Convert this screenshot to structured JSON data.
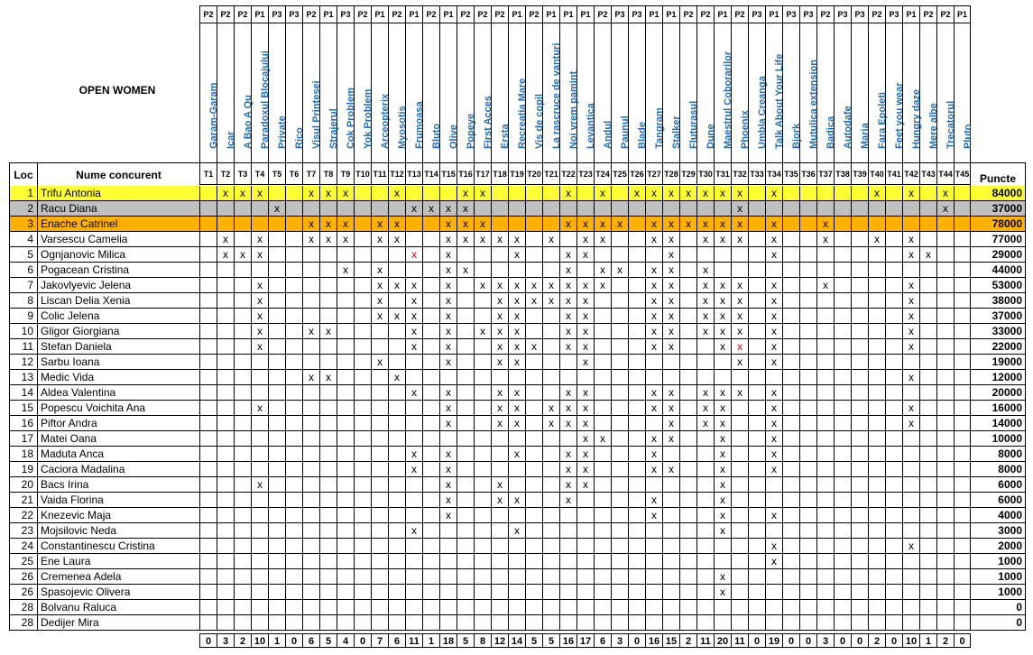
{
  "title": "OPEN WOMEN",
  "headers": {
    "loc": "Loc",
    "name": "Nume concurent",
    "points": "Puncte"
  },
  "routes": [
    {
      "code": "T1",
      "level": "P2",
      "name": "Garam-Garam"
    },
    {
      "code": "T2",
      "level": "P2",
      "name": "Icar"
    },
    {
      "code": "T3",
      "level": "P2",
      "name": "A Bao A Qu"
    },
    {
      "code": "T4",
      "level": "P1",
      "name": "Paradoxul Blocajului"
    },
    {
      "code": "T5",
      "level": "P3",
      "name": "Private"
    },
    {
      "code": "T6",
      "level": "P3",
      "name": "Rico"
    },
    {
      "code": "T7",
      "level": "P2",
      "name": "Visul Printesei"
    },
    {
      "code": "T8",
      "level": "P1",
      "name": "Strajerul"
    },
    {
      "code": "T9",
      "level": "P3",
      "name": "Cok Problem"
    },
    {
      "code": "T10",
      "level": "P2",
      "name": "Yok Problem"
    },
    {
      "code": "T11",
      "level": "P1",
      "name": "Arceopterix"
    },
    {
      "code": "T12",
      "level": "P2",
      "name": "Myosotis"
    },
    {
      "code": "T13",
      "level": "P1",
      "name": "Frumoasa"
    },
    {
      "code": "T14",
      "level": "P2",
      "name": "Bluto"
    },
    {
      "code": "T15",
      "level": "P1",
      "name": "Olive"
    },
    {
      "code": "T16",
      "level": "P2",
      "name": "Popeye"
    },
    {
      "code": "T17",
      "level": "P2",
      "name": "First Acces"
    },
    {
      "code": "T18",
      "level": "P2",
      "name": "Ersta"
    },
    {
      "code": "T19",
      "level": "P1",
      "name": "Recreatia Mare"
    },
    {
      "code": "T20",
      "level": "P2",
      "name": "Vis de copil"
    },
    {
      "code": "T21",
      "level": "P1",
      "name": "La rascruce de vanturi"
    },
    {
      "code": "T22",
      "level": "P1",
      "name": "Noi vrem pamint"
    },
    {
      "code": "T23",
      "level": "P1",
      "name": "Levantica"
    },
    {
      "code": "T24",
      "level": "P2",
      "name": "Andul"
    },
    {
      "code": "T25",
      "level": "P3",
      "name": "Paunul"
    },
    {
      "code": "T26",
      "level": "P3",
      "name": "Blade"
    },
    {
      "code": "T27",
      "level": "P1",
      "name": "Tangram"
    },
    {
      "code": "T28",
      "level": "P1",
      "name": "Stalker"
    },
    {
      "code": "T29",
      "level": "P2",
      "name": "Fluturasul"
    },
    {
      "code": "T30",
      "level": "P2",
      "name": "Dune"
    },
    {
      "code": "T31",
      "level": "P1",
      "name": "Maestrul Coborarilor"
    },
    {
      "code": "T32",
      "level": "P2",
      "name": "Phoenix"
    },
    {
      "code": "T33",
      "level": "P3",
      "name": "Umbla Creanga"
    },
    {
      "code": "T34",
      "level": "P1",
      "name": "Talk About Your Life"
    },
    {
      "code": "T35",
      "level": "P3",
      "name": "Bjork"
    },
    {
      "code": "T36",
      "level": "P3",
      "name": "Mutulica extension"
    },
    {
      "code": "T37",
      "level": "P2",
      "name": "Badica"
    },
    {
      "code": "T38",
      "level": "P3",
      "name": "Autodafe"
    },
    {
      "code": "T39",
      "level": "P3",
      "name": "Maria"
    },
    {
      "code": "T40",
      "level": "P2",
      "name": "Fara Epoleti"
    },
    {
      "code": "T41",
      "level": "P3",
      "name": "Feet you wear"
    },
    {
      "code": "T42",
      "level": "P1",
      "name": "Hungry daze"
    },
    {
      "code": "T43",
      "level": "P2",
      "name": "Mere albe"
    },
    {
      "code": "T44",
      "level": "P2",
      "name": "Trecatorul"
    },
    {
      "code": "T45",
      "level": "P1",
      "name": "Pluto"
    }
  ],
  "rows": [
    {
      "rank": "1",
      "name": "Trifu Antonia",
      "hl": "yellow",
      "marks": [
        2,
        3,
        4,
        7,
        8,
        9,
        12,
        16,
        17,
        22,
        24,
        26,
        27,
        28,
        29,
        30,
        31,
        32,
        34,
        40,
        42,
        44
      ],
      "red": [],
      "points": "84000"
    },
    {
      "rank": "2",
      "name": "Racu Diana",
      "hl": "gray",
      "marks": [
        5,
        13,
        14,
        15,
        16,
        32,
        44
      ],
      "red": [],
      "points": "37000"
    },
    {
      "rank": "3",
      "name": "Enache Catrinel",
      "hl": "orange",
      "marks": [
        7,
        8,
        9,
        11,
        12,
        15,
        16,
        17,
        22,
        23,
        24,
        25,
        27,
        28,
        29,
        30,
        31,
        32,
        34,
        37
      ],
      "red": [],
      "points": "78000"
    },
    {
      "rank": "4",
      "name": "Varsescu Camelia",
      "hl": "",
      "marks": [
        2,
        4,
        7,
        8,
        9,
        11,
        12,
        15,
        16,
        17,
        18,
        19,
        21,
        23,
        24,
        27,
        28,
        30,
        31,
        32,
        34,
        37,
        40,
        42
      ],
      "red": [],
      "points": "77000"
    },
    {
      "rank": "5",
      "name": "Ognjanovic Milica",
      "hl": "",
      "marks": [
        2,
        3,
        4,
        13,
        15,
        19,
        22,
        23,
        28,
        34,
        42,
        43
      ],
      "red": [
        13
      ],
      "points": "29000"
    },
    {
      "rank": "6",
      "name": "Pogacean Cristina",
      "hl": "",
      "marks": [
        9,
        11,
        15,
        16,
        22,
        24,
        25,
        27,
        28,
        30
      ],
      "red": [],
      "points": "44000"
    },
    {
      "rank": "7",
      "name": "Jakovlyevic Jelena",
      "hl": "",
      "marks": [
        4,
        11,
        12,
        13,
        15,
        17,
        18,
        19,
        20,
        21,
        22,
        23,
        24,
        27,
        28,
        30,
        31,
        32,
        34,
        37,
        42
      ],
      "red": [],
      "points": "53000"
    },
    {
      "rank": "8",
      "name": "Liscan Delia Xenia",
      "hl": "",
      "marks": [
        4,
        11,
        13,
        15,
        18,
        19,
        20,
        21,
        22,
        23,
        27,
        28,
        30,
        31,
        32,
        34,
        42
      ],
      "red": [],
      "points": "38000"
    },
    {
      "rank": "9",
      "name": "Colic Jelena",
      "hl": "",
      "marks": [
        4,
        11,
        12,
        13,
        15,
        18,
        19,
        22,
        23,
        27,
        28,
        30,
        31,
        32,
        34,
        42
      ],
      "red": [],
      "points": "37000"
    },
    {
      "rank": "10",
      "name": "Gligor Giorgiana",
      "hl": "",
      "marks": [
        4,
        7,
        8,
        13,
        15,
        17,
        18,
        19,
        22,
        23,
        27,
        28,
        30,
        31,
        32,
        34,
        42
      ],
      "red": [],
      "points": "33000"
    },
    {
      "rank": "11",
      "name": "Stefan Daniela",
      "hl": "",
      "marks": [
        4,
        13,
        15,
        18,
        19,
        20,
        22,
        23,
        27,
        28,
        31,
        32,
        34,
        42
      ],
      "red": [
        32
      ],
      "points": "22000"
    },
    {
      "rank": "12",
      "name": "Sarbu Ioana",
      "hl": "",
      "marks": [
        11,
        15,
        18,
        19,
        23,
        32,
        34
      ],
      "red": [],
      "points": "19000"
    },
    {
      "rank": "13",
      "name": "Medic Vida",
      "hl": "",
      "marks": [
        7,
        8,
        12,
        42
      ],
      "red": [],
      "points": "12000"
    },
    {
      "rank": "14",
      "name": "Aldea Valentina",
      "hl": "",
      "marks": [
        13,
        15,
        18,
        19,
        22,
        23,
        27,
        28,
        30,
        31,
        32,
        34
      ],
      "red": [],
      "points": "20000"
    },
    {
      "rank": "15",
      "name": "Popescu Voichita Ana",
      "hl": "",
      "marks": [
        4,
        15,
        18,
        19,
        21,
        22,
        23,
        27,
        28,
        30,
        31,
        34,
        42
      ],
      "red": [],
      "points": "16000"
    },
    {
      "rank": "16",
      "name": "Piftor Andra",
      "hl": "",
      "marks": [
        15,
        18,
        19,
        21,
        22,
        23,
        28,
        30,
        31,
        34,
        42
      ],
      "red": [],
      "points": "14000"
    },
    {
      "rank": "17",
      "name": "Matei Oana",
      "hl": "",
      "marks": [
        23,
        24,
        27,
        28,
        31,
        34
      ],
      "red": [],
      "points": "10000"
    },
    {
      "rank": "18",
      "name": "Maduta Anca",
      "hl": "",
      "marks": [
        13,
        15,
        19,
        22,
        23,
        27,
        31,
        34
      ],
      "red": [],
      "points": "8000"
    },
    {
      "rank": "19",
      "name": "Caciora Madalina",
      "hl": "",
      "marks": [
        13,
        15,
        22,
        23,
        27,
        28,
        31,
        34
      ],
      "red": [],
      "points": "8000"
    },
    {
      "rank": "20",
      "name": "Bacs Irina",
      "hl": "",
      "marks": [
        4,
        15,
        18,
        22,
        23,
        31
      ],
      "red": [],
      "points": "6000"
    },
    {
      "rank": "21",
      "name": "Vaida Florina",
      "hl": "",
      "marks": [
        15,
        18,
        19,
        22,
        27,
        31
      ],
      "red": [],
      "points": "6000"
    },
    {
      "rank": "22",
      "name": "Knezevic Maja",
      "hl": "",
      "marks": [
        15,
        27,
        31,
        34
      ],
      "red": [],
      "points": "4000"
    },
    {
      "rank": "23",
      "name": "Mojsilovic Neda",
      "hl": "",
      "marks": [
        13,
        19,
        31
      ],
      "red": [],
      "points": "3000"
    },
    {
      "rank": "24",
      "name": "Constantinescu Cristina",
      "hl": "",
      "marks": [
        34,
        42
      ],
      "red": [],
      "points": "2000"
    },
    {
      "rank": "25",
      "name": "Ene Laura",
      "hl": "",
      "marks": [
        34
      ],
      "red": [],
      "points": "1000"
    },
    {
      "rank": "26",
      "name": "Cremenea Adela",
      "hl": "",
      "marks": [
        31
      ],
      "red": [],
      "points": "1000"
    },
    {
      "rank": "26",
      "name": "Spasojevic Olivera",
      "hl": "",
      "marks": [
        31
      ],
      "red": [],
      "points": "1000"
    },
    {
      "rank": "28",
      "name": "Bolvanu Raluca",
      "hl": "",
      "marks": [],
      "red": [],
      "points": "0"
    },
    {
      "rank": "28",
      "name": "Dedijer Mira",
      "hl": "",
      "marks": [],
      "red": [],
      "points": "0"
    }
  ],
  "totals": [
    "0",
    "3",
    "2",
    "10",
    "1",
    "0",
    "6",
    "5",
    "4",
    "0",
    "7",
    "6",
    "11",
    "1",
    "18",
    "5",
    "8",
    "12",
    "14",
    "5",
    "5",
    "16",
    "17",
    "6",
    "3",
    "0",
    "16",
    "15",
    "2",
    "11",
    "20",
    "11",
    "0",
    "19",
    "0",
    "0",
    "3",
    "0",
    "0",
    "2",
    "0",
    "10",
    "1",
    "2",
    "0"
  ],
  "colors": {
    "yellow": "#ffff33",
    "gray": "#c0c0c0",
    "orange": "#ffb000",
    "route_name": "#1e6fb5",
    "red_mark": "#dd0000"
  }
}
